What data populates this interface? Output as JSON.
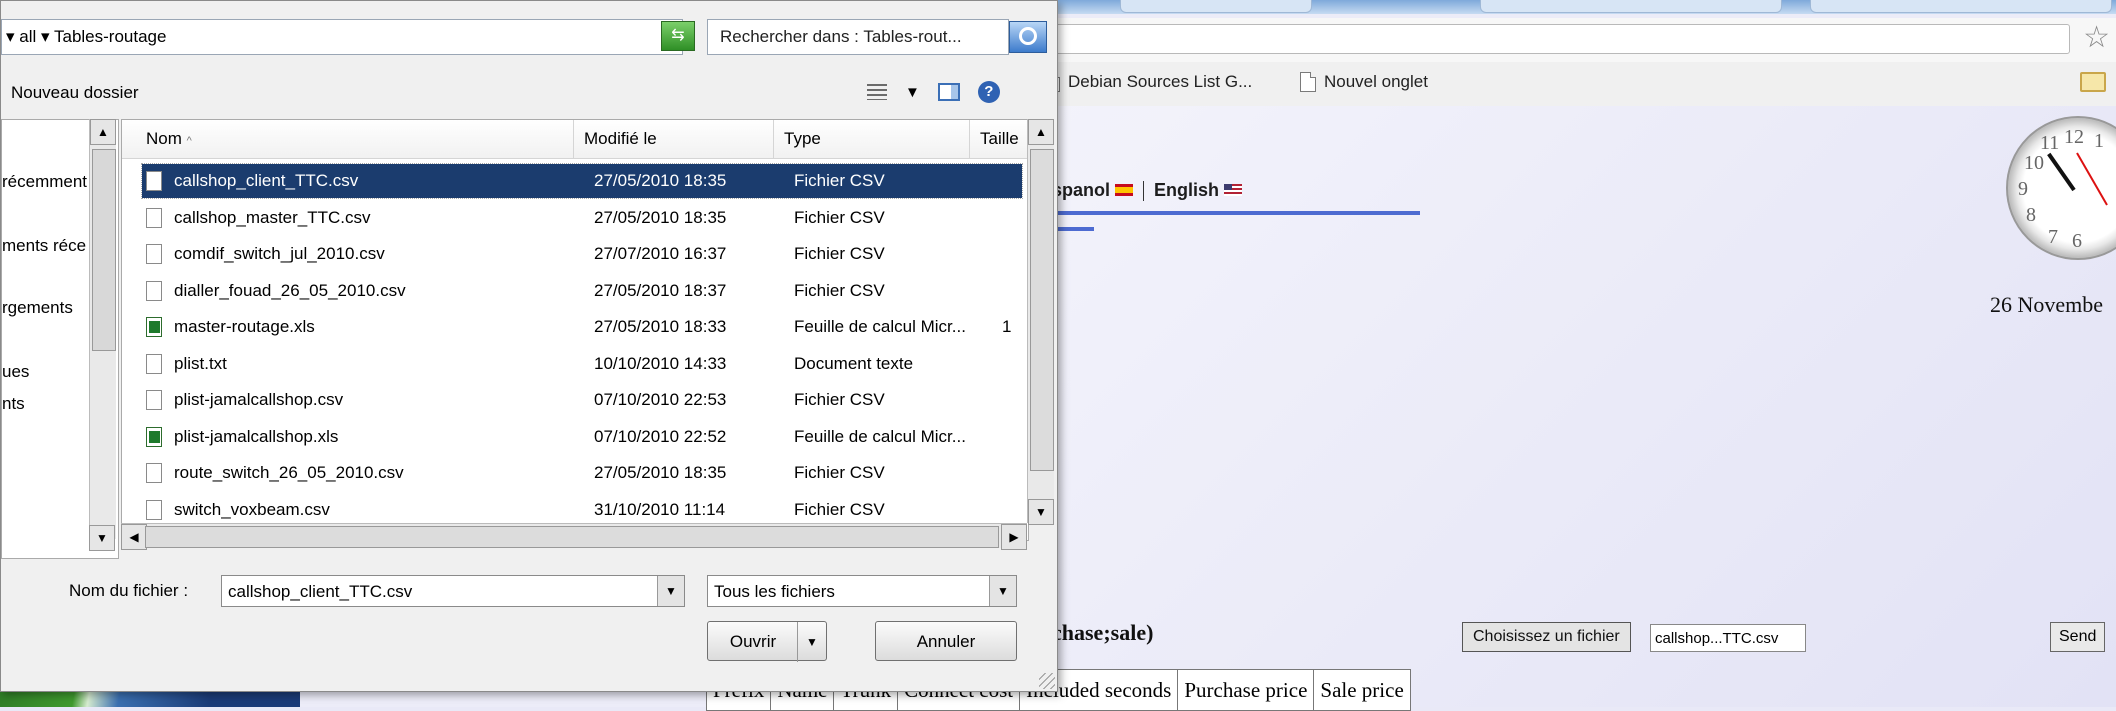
{
  "browser": {
    "bookmarks": [
      {
        "label": "Debian Sources List G..."
      },
      {
        "label": "Nouvel onglet"
      }
    ],
    "languages": {
      "es": "spanol",
      "en": "English"
    },
    "clock": {
      "numerals": [
        "12",
        "11",
        "10",
        "9",
        "8",
        "7",
        "6",
        "1"
      ]
    },
    "date": "26 Novembe",
    "section_title": "chase;sale)",
    "choose_file_button": "Choisissez un fichier",
    "chosen_file": "callshop...TTC.csv",
    "send_button": "Send",
    "table_headers": [
      "Prefix",
      "Name",
      "Trunk",
      "Connect cost",
      "Included seconds",
      "Purchase price",
      "Sale price"
    ]
  },
  "dialog": {
    "breadcrumb": [
      "all",
      "Tables-routage"
    ],
    "search_placeholder": "Rechercher dans : Tables-rout...",
    "new_folder": "Nouveau dossier",
    "nav_items": [
      "récemment",
      "ments réce",
      "rgements",
      "ues",
      "nts"
    ],
    "columns": {
      "name": "Nom",
      "modified": "Modifié le",
      "type": "Type",
      "size": "Taille"
    },
    "files": [
      {
        "name": "callshop_client_TTC.csv",
        "modified": "27/05/2010 18:35",
        "type": "Fichier CSV",
        "size": "",
        "icon": "csv",
        "selected": true
      },
      {
        "name": "callshop_master_TTC.csv",
        "modified": "27/05/2010 18:35",
        "type": "Fichier CSV",
        "size": "",
        "icon": "csv"
      },
      {
        "name": "comdif_switch_jul_2010.csv",
        "modified": "27/07/2010 16:37",
        "type": "Fichier CSV",
        "size": "",
        "icon": "csv"
      },
      {
        "name": "dialler_fouad_26_05_2010.csv",
        "modified": "27/05/2010 18:37",
        "type": "Fichier CSV",
        "size": "",
        "icon": "csv"
      },
      {
        "name": "master-routage.xls",
        "modified": "27/05/2010 18:33",
        "type": "Feuille de calcul Micr...",
        "size": "1",
        "icon": "xls"
      },
      {
        "name": "plist.txt",
        "modified": "10/10/2010 14:33",
        "type": "Document texte",
        "size": "",
        "icon": "txt"
      },
      {
        "name": "plist-jamalcallshop.csv",
        "modified": "07/10/2010 22:53",
        "type": "Fichier CSV",
        "size": "",
        "icon": "csv"
      },
      {
        "name": "plist-jamalcallshop.xls",
        "modified": "07/10/2010 22:52",
        "type": "Feuille de calcul Micr...",
        "size": "",
        "icon": "xls"
      },
      {
        "name": "route_switch_26_05_2010.csv",
        "modified": "27/05/2010 18:35",
        "type": "Fichier CSV",
        "size": "",
        "icon": "csv"
      },
      {
        "name": "switch_voxbeam.csv",
        "modified": "31/10/2010 11:14",
        "type": "Fichier CSV",
        "size": "",
        "icon": "csv"
      }
    ],
    "filename_label": "Nom du fichier :",
    "filename_value": "callshop_client_TTC.csv",
    "filetype_value": "Tous les fichiers",
    "open_button": "Ouvrir",
    "cancel_button": "Annuler"
  }
}
